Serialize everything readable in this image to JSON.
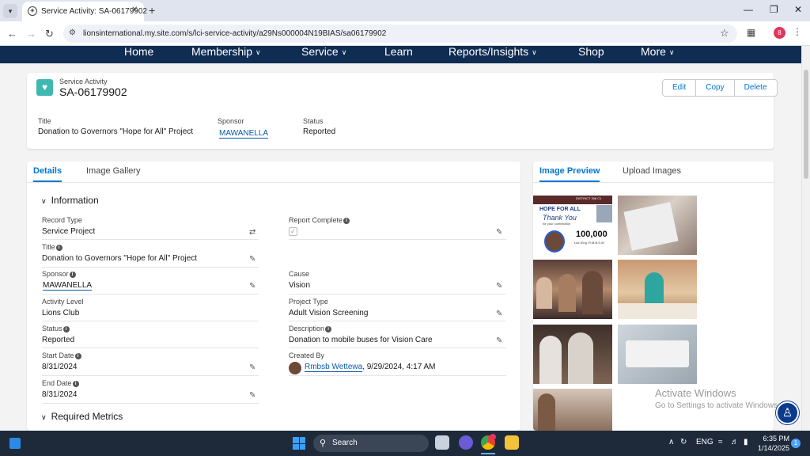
{
  "browser": {
    "tab_title": "Service Activity: SA-06179902",
    "url": "lionsinternational.my.site.com/s/lci-service-activity/a29Ns000004N19BIAS/sa06179902",
    "profile_initial": "8"
  },
  "site_nav": {
    "items": [
      "Home",
      "Membership",
      "Service",
      "Learn",
      "Reports/Insights",
      "Shop",
      "More"
    ]
  },
  "record": {
    "object_label": "Service Activity",
    "name": "SA-06179902",
    "actions": [
      "Edit",
      "Copy",
      "Delete"
    ],
    "highlights": {
      "title_label": "Title",
      "title_value": "Donation to Governors \"Hope for All\" Project",
      "sponsor_label": "Sponsor",
      "sponsor_value": "MAWANELLA",
      "status_label": "Status",
      "status_value": "Reported"
    }
  },
  "left_tabs": [
    "Details",
    "Image Gallery"
  ],
  "sections": {
    "information": "Information",
    "required_metrics": "Required Metrics"
  },
  "fields_left": [
    {
      "label": "Record Type",
      "value": "Service Project"
    },
    {
      "label": "Title",
      "value": "Donation to Governors \"Hope for All\" Project"
    },
    {
      "label": "Sponsor",
      "value": "MAWANELLA"
    },
    {
      "label": "Activity Level",
      "value": "Lions Club"
    },
    {
      "label": "Status",
      "value": "Reported"
    },
    {
      "label": "Start Date",
      "value": "8/31/2024"
    },
    {
      "label": "End Date",
      "value": "8/31/2024"
    }
  ],
  "fields_right": [
    {
      "label": "Report Complete",
      "value": ""
    },
    {
      "label": "Cause",
      "value": "Vision"
    },
    {
      "label": "Project Type",
      "value": "Adult Vision Screening"
    },
    {
      "label": "Description",
      "value": "Donation to mobile buses for Vision Care"
    },
    {
      "label": "Created By",
      "value": "Rmbsb Wettewa",
      "timestamp": ", 9/29/2024, 4:17 AM"
    }
  ],
  "right_tabs": [
    "Image Preview",
    "Upload Images"
  ],
  "poster": {
    "heading": "HOPE FOR ALL",
    "thanks": "Thank You",
    "subtitle": "for your contribution",
    "amount": "100,000",
    "name": "Lion Eng. R.M.B.S.W",
    "district": "DISTRICT 306 C1"
  },
  "watermark": {
    "line1": "Activate Windows",
    "line2": "Go to Settings to activate Windows."
  },
  "taskbar": {
    "search": "Search",
    "lang": "ENG",
    "time": "6:35 PM",
    "date": "1/14/2025",
    "notifications": "1"
  },
  "colors": {
    "site_nav": "#0f2d53",
    "brand_blue": "#0176d3",
    "record_icon": "#3fb8b0"
  }
}
